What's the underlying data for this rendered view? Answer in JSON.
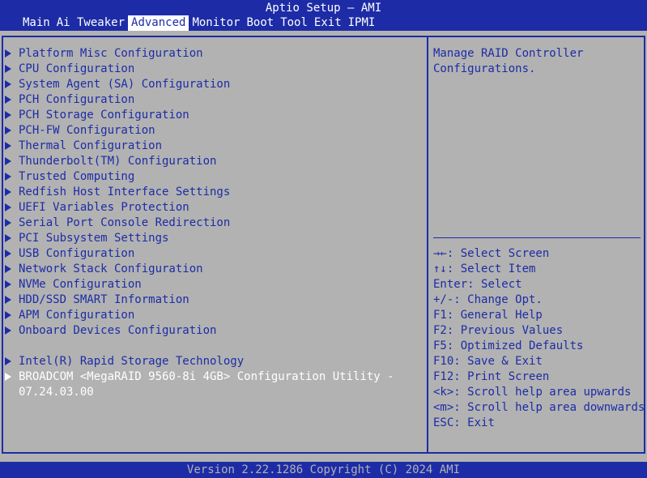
{
  "title": "Aptio Setup – AMI",
  "tabs": [
    "Main",
    "Ai Tweaker",
    "Advanced",
    "Monitor",
    "Boot",
    "Tool",
    "Exit",
    "IPMI"
  ],
  "active_tab": "Advanced",
  "menu_items": [
    "Platform Misc Configuration",
    "CPU Configuration",
    "System Agent (SA) Configuration",
    "PCH Configuration",
    "PCH Storage Configuration",
    "PCH-FW Configuration",
    "Thermal Configuration",
    "Thunderbolt(TM) Configuration",
    "Trusted Computing",
    "Redfish Host Interface Settings",
    "UEFI Variables Protection",
    "Serial Port Console Redirection",
    "PCI Subsystem Settings",
    "USB Configuration",
    "Network Stack Configuration",
    "NVMe Configuration",
    "HDD/SSD SMART Information",
    "APM Configuration",
    "Onboard Devices Configuration"
  ],
  "storage_items": [
    "Intel(R) Rapid Storage Technology",
    "BROADCOM <MegaRAID 9560-8i 4GB> Configuration Utility -"
  ],
  "selected_item_continuation": "07.24.03.00",
  "help": {
    "line1": "Manage RAID Controller",
    "line2": "Configurations."
  },
  "key_help": [
    {
      "key": "→←",
      "desc": ": Select Screen"
    },
    {
      "key": "↑↓",
      "desc": ": Select Item"
    },
    {
      "key": "Enter",
      "desc": ": Select"
    },
    {
      "key": "+/-",
      "desc": ": Change Opt."
    },
    {
      "key": "F1",
      "desc": ": General Help"
    },
    {
      "key": "F2",
      "desc": ": Previous Values"
    },
    {
      "key": "F5",
      "desc": ": Optimized Defaults"
    },
    {
      "key": "F10",
      "desc": ": Save & Exit"
    },
    {
      "key": "F12",
      "desc": ": Print Screen"
    },
    {
      "key": "<k>",
      "desc": ": Scroll help area upwards"
    },
    {
      "key": "<m>",
      "desc": ": Scroll help area downwards"
    },
    {
      "key": "ESC",
      "desc": ": Exit"
    }
  ],
  "footer": "Version 2.22.1286 Copyright (C) 2024 AMI",
  "colors": {
    "blue": "#1d2ca6",
    "gray": "#b2b2b2",
    "white": "#ffffff"
  }
}
